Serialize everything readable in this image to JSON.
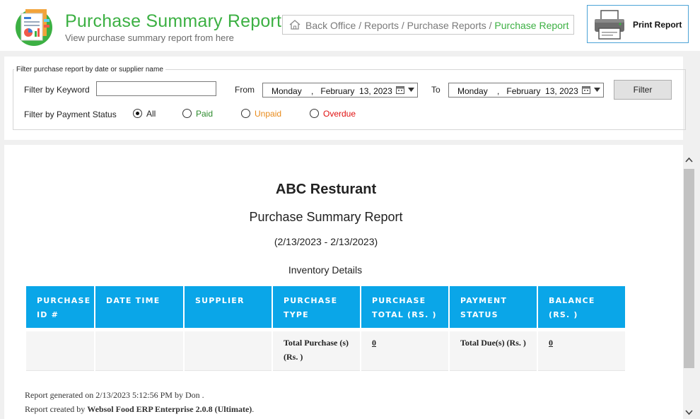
{
  "header": {
    "title": "Purchase Summary Report",
    "subtitle": "View purchase summary report from here",
    "breadcrumb": {
      "path": "Back Office / Reports / Purchase Reports / ",
      "current": "Purchase Report"
    },
    "print_label": "Print Report"
  },
  "filter": {
    "legend": "Filter purchase report by date or supplier name",
    "keyword_label": "Filter by Keyword",
    "keyword_value": "",
    "from_label": "From",
    "from_date": "Monday    ,   February  13, 2023",
    "to_label": "To",
    "to_date": "Monday    ,   February  13, 2023",
    "filter_button": "Filter",
    "payment_status_label": "Filter by Payment Status",
    "options": [
      {
        "label": "All",
        "color": "#222222",
        "selected": true
      },
      {
        "label": "Paid",
        "color": "#2e8b2e",
        "selected": false
      },
      {
        "label": "Unpaid",
        "color": "#e88a1a",
        "selected": false
      },
      {
        "label": "Overdue",
        "color": "#e01010",
        "selected": false
      }
    ]
  },
  "report": {
    "company": "ABC Resturant",
    "title": "Purchase Summary Report",
    "date_range": "(2/13/2023 - 2/13/2023)",
    "section": "Inventory Details",
    "columns": [
      "PURCHASE ID #",
      "DATE TIME",
      "SUPPLIER",
      "PURCHASE TYPE",
      "PURCHASE TOTAL (RS. )",
      "PAYMENT STATUS",
      "BALANCE (RS. )"
    ],
    "totals": {
      "total_purchase_label": "Total Purchase (s) (Rs. )",
      "total_purchase_value": "0",
      "total_due_label": "Total Due(s) (Rs. )",
      "total_due_value": "0"
    },
    "footer": {
      "generated": "Report generated on 2/13/2023 5:12:56 PM by Don .",
      "created_prefix": "Report created by ",
      "created_product": "Websol Food ERP Enterprise 2.0.8 (Ultimate)",
      "created_suffix": "."
    }
  },
  "colors": {
    "accent_green": "#3cb043",
    "table_header": "#0aa6e8",
    "print_border": "#4ba3d6"
  }
}
